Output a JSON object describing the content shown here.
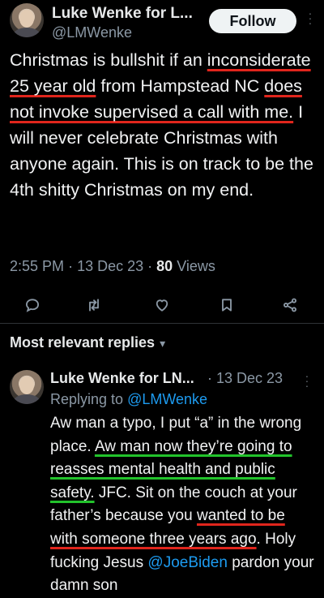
{
  "tweet": {
    "author_name": "Luke Wenke for L...",
    "author_handle": "@LMWenke",
    "follow_label": "Follow",
    "text": {
      "p1": "Christmas is bullshit if an ",
      "u1": "inconsiderate 25 year old",
      "p2": " from Hampstead NC ",
      "u2": "does not invoke supervised a call with me.",
      "p3": " I will never celebrate Christmas with anyone again.  This is on track to be the 4th shitty Christmas on my end."
    },
    "time": "2:55 PM",
    "date": "13 Dec 23",
    "views_count": "80",
    "views_label": "Views",
    "sep": "·"
  },
  "actions": {
    "icons": [
      "reply-icon",
      "retweet-icon",
      "like-icon",
      "bookmark-icon",
      "share-icon"
    ]
  },
  "replies_header": "Most relevant replies",
  "reply": {
    "author_name": "Luke Wenke for LN...",
    "date": "· 13 Dec 23",
    "replying_prefix": "Replying to ",
    "replying_handle": "@LMWenke",
    "text": {
      "p1": "Aw man a typo, I put “a” in the wrong place. ",
      "g1": "Aw man now they’re going to reasses mental health and public safety.",
      "p2": " JFC. Sit on the couch at your father’s because you ",
      "r1": "wanted to be with someone three years ago",
      "p3": ". Holy fucking Jesus ",
      "mention": "@JoeBiden",
      "p4": " pardon your damn son"
    }
  },
  "colors": {
    "background": "#000000",
    "text": "#e7e9ea",
    "secondary": "#8b98a5",
    "link": "#1d9bf0",
    "underline_red": "#e0251c",
    "underline_green": "#22c22b"
  }
}
